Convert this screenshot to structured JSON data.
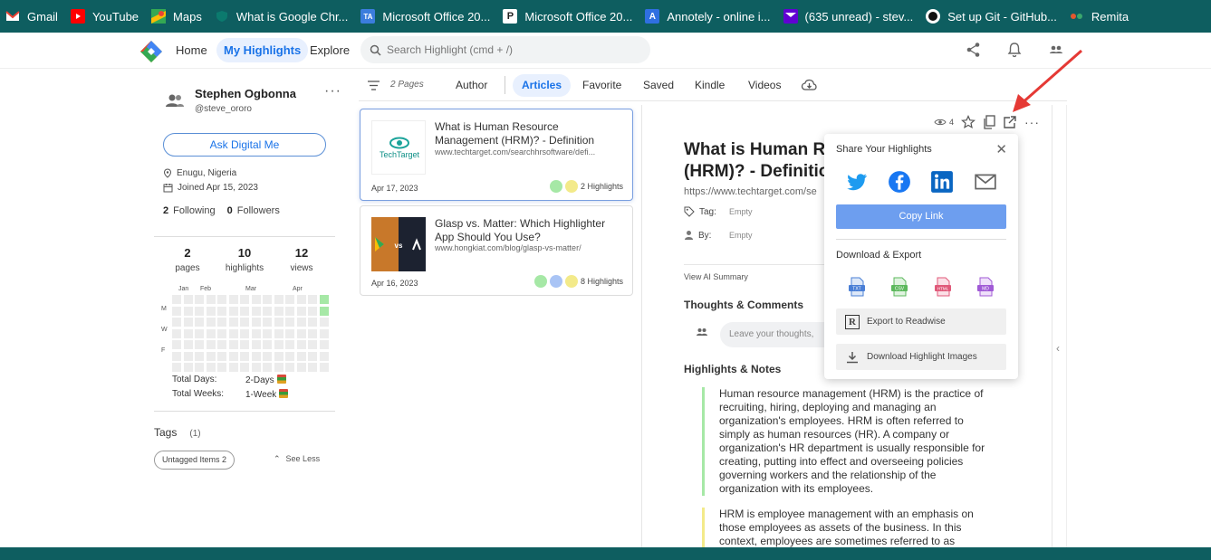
{
  "bookmarks": [
    {
      "label": "Gmail",
      "icon": "gmail-icon",
      "color": "#ea4335"
    },
    {
      "label": "YouTube",
      "icon": "youtube-icon",
      "color": "#ff0000"
    },
    {
      "label": "Maps",
      "icon": "maps-icon",
      "color": "#34a853"
    },
    {
      "label": "What is Google Chr...",
      "icon": "google-chrome-shield-icon",
      "color": "#0b7a6e"
    },
    {
      "label": "Microsoft Office 20...",
      "icon": "ta-icon",
      "color": "#3b7ddd"
    },
    {
      "label": "Microsoft Office 20...",
      "icon": "p-icon",
      "color": "#333333"
    },
    {
      "label": "Annotely - online i...",
      "icon": "annotely-icon",
      "color": "#2f6fe0"
    },
    {
      "label": "(635 unread) - stev...",
      "icon": "yahoo-mail-icon",
      "color": "#6001d2"
    },
    {
      "label": "Set up Git - GitHub...",
      "icon": "github-icon",
      "color": "#111111"
    },
    {
      "label": "Remita",
      "icon": "remita-icon",
      "color": "#e4572e"
    }
  ],
  "header": {
    "nav": [
      "Home",
      "My Highlights",
      "Explore"
    ],
    "active_nav": "My Highlights",
    "search_placeholder": "Search Highlight (cmd + /)"
  },
  "profile": {
    "name": "Stephen Ogbonna",
    "handle": "@steve_ororo",
    "ask_button": "Ask Digital Me",
    "location": "Enugu, Nigeria",
    "joined": "Joined Apr 15, 2023",
    "following_count": "2",
    "following_label": "Following",
    "followers_count": "0",
    "followers_label": "Followers",
    "stats": [
      {
        "value": "2",
        "label": "pages"
      },
      {
        "value": "10",
        "label": "highlights"
      },
      {
        "value": "12",
        "label": "views"
      }
    ],
    "months": [
      "Jan",
      "Feb",
      "Mar",
      "Apr"
    ],
    "days": [
      "M",
      "W",
      "F"
    ],
    "total_days_label": "Total Days:",
    "total_days_value": "2-Days",
    "total_weeks_label": "Total Weeks:",
    "total_weeks_value": "1-Week",
    "tags_label": "Tags",
    "tags_count": "(1)",
    "tag_chip": "Untagged Items 2",
    "see_less": "See Less"
  },
  "filters": {
    "pages_count": "2 Pages",
    "items": [
      "Author",
      "Articles",
      "Favorite",
      "Saved",
      "Kindle",
      "Videos"
    ],
    "active": "Articles"
  },
  "articles": [
    {
      "title": "What is Human Resource Management (HRM)? - Definition",
      "url": "www.techtarget.com/searchhrsoftware/defi...",
      "date": "Apr 17, 2023",
      "highlights": "2 Highlights",
      "thumb_text": "TechTarget",
      "dot_colors": [
        "#a6e8a6",
        "#f3ea8a"
      ]
    },
    {
      "title": "Glasp vs. Matter: Which Highlighter App Should You Use?",
      "url": "www.hongkiat.com/blog/glasp-vs-matter/",
      "date": "Apr 16, 2023",
      "highlights": "8 Highlights",
      "thumb_text": "vs",
      "dot_colors": [
        "#a6e8a6",
        "#a9c4f5",
        "#f3ea8a"
      ]
    }
  ],
  "reader": {
    "views": "4",
    "title_line1": "What is Human Re",
    "title_line2": "(HRM)? - Definitio",
    "url": "https://www.techtarget.com/se",
    "tag_label": "Tag:",
    "tag_value": "Empty",
    "by_label": "By:",
    "by_value": "Empty",
    "ai_summary": "View AI Summary",
    "thoughts_heading": "Thoughts & Comments",
    "thoughts_placeholder": "Leave your thoughts,",
    "highlights_heading": "Highlights & Notes",
    "highlight1": "Human resource management (HRM) is the practice of recruiting, hiring, deploying and managing an organization's employees. HRM is often referred to simply as human resources (HR). A company or organization's HR department is usually responsible for creating, putting into effect and overseeing policies governing workers and the relationship of the organization with its employees.",
    "highlight2": "HRM is employee management with an emphasis on those employees as assets of the business. In this context, employees are sometimes referred to as"
  },
  "share": {
    "heading": "Share Your Highlights",
    "copy_link": "Copy Link",
    "download_heading": "Download & Export",
    "formats": [
      "TXT",
      "CSV",
      "HTML",
      "MD"
    ],
    "format_colors": [
      "#4a7fd6",
      "#5cb85c",
      "#e05a7a",
      "#a05ad6"
    ],
    "export_readwise": "Export to Readwise",
    "download_images": "Download Highlight Images"
  }
}
